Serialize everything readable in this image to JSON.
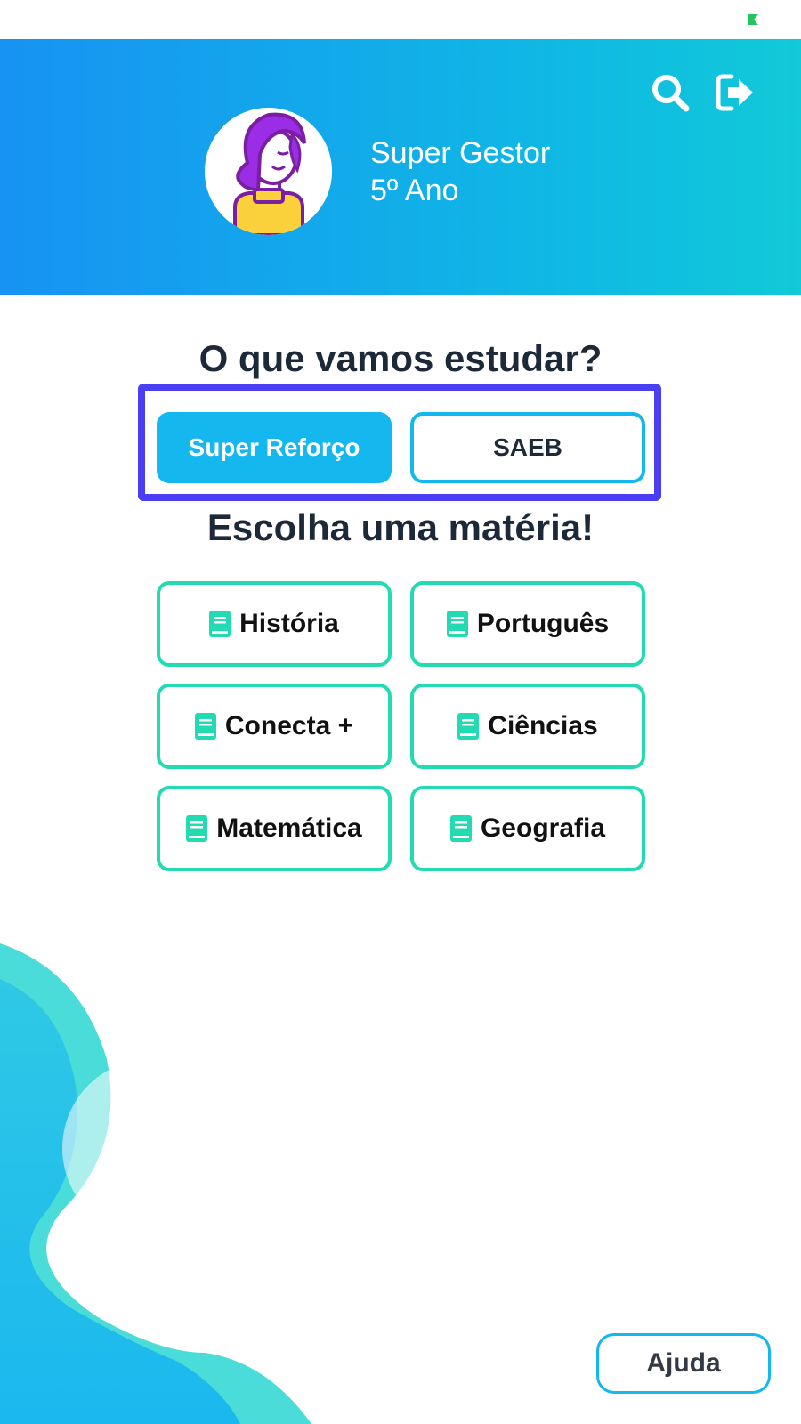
{
  "user": {
    "name": "Super Gestor",
    "grade": "5º Ano"
  },
  "header": {
    "search_icon": "search-icon",
    "logout_icon": "logout-icon"
  },
  "question": "O que vamos estudar?",
  "modes": [
    {
      "label": "Super Reforço",
      "active": true
    },
    {
      "label": "SAEB",
      "active": false
    }
  ],
  "choose_subject": "Escolha uma matéria!",
  "subjects": [
    {
      "label": "História",
      "icon": "book-icon"
    },
    {
      "label": "Português",
      "icon": "book-icon"
    },
    {
      "label": "Conecta +",
      "icon": "book-icon"
    },
    {
      "label": "Ciências",
      "icon": "book-icon"
    },
    {
      "label": "Matemática",
      "icon": "book-icon"
    },
    {
      "label": "Geografia",
      "icon": "book-icon"
    }
  ],
  "help_label": "Ajuda",
  "colors": {
    "header_gradient_start": "#1793f3",
    "header_gradient_end": "#12c9d8",
    "accent_blue": "#14b8ee",
    "subject_border": "#22dbb2",
    "highlight_box": "#4b3ff3",
    "title_text": "#1d2939"
  }
}
